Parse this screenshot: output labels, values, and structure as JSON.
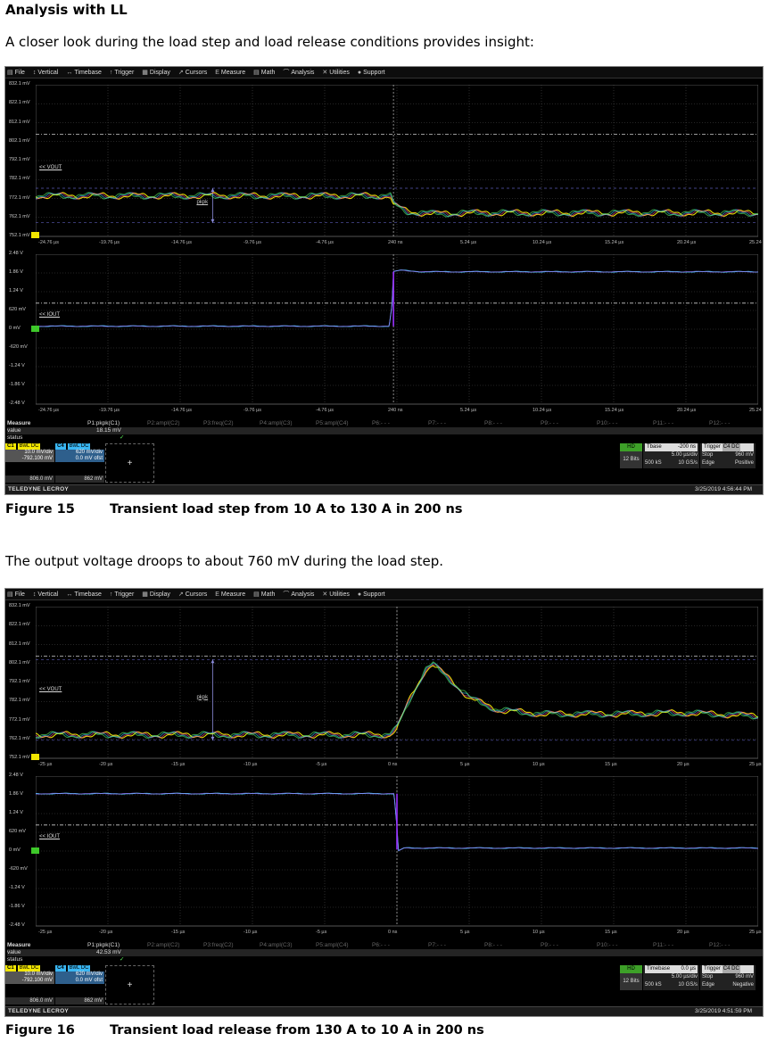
{
  "heading": "Analysis with LL",
  "intro": "A closer look during the load step and load release conditions provides insight:",
  "between_text": "The output voltage droops to about 760 mV during the load step.",
  "menu": [
    {
      "icon": "file-icon",
      "glyph": "▤",
      "label": "File"
    },
    {
      "icon": "vertical-icon",
      "glyph": "↕",
      "label": "Vertical"
    },
    {
      "icon": "timebase-icon",
      "glyph": "↔",
      "label": "Timebase"
    },
    {
      "icon": "trigger-icon",
      "glyph": "↑",
      "label": "Trigger"
    },
    {
      "icon": "display-icon",
      "glyph": "▦",
      "label": "Display"
    },
    {
      "icon": "cursors-icon",
      "glyph": "↗",
      "label": "Cursors"
    },
    {
      "icon": "measure-icon",
      "glyph": "Ε",
      "label": "Measure"
    },
    {
      "icon": "math-icon",
      "glyph": "▤",
      "label": "Math"
    },
    {
      "icon": "analysis-icon",
      "glyph": "⌒",
      "label": "Analysis"
    },
    {
      "icon": "utilities-icon",
      "glyph": "✕",
      "label": "Utilities"
    },
    {
      "icon": "support-icon",
      "glyph": "●",
      "label": "Support"
    }
  ],
  "colors": {
    "ch1": "#f2e600",
    "ch4": "#39b6f2",
    "marker_green": "#3ec82a",
    "grid": "#4a4a4a"
  },
  "common": {
    "vout_tag": "<< VOUT",
    "iout_tag": "<< IOUT",
    "cursor_label": "pkpk",
    "brand": "TELEDYNE LECROY",
    "measure_row_label": "Measure",
    "value_row_label": "value",
    "status_row_label": "status",
    "status_mark": "✓",
    "p1": "P1:pkpk(C1)",
    "others": [
      "P2:ampl(C2)",
      "P3:freq(C2)",
      "P4:ampl(C3)",
      "P5:ampl(C4)",
      "P6:- - -",
      "P7:- - -",
      "P8:- - -",
      "P9:- - -",
      "P10:- - -",
      "P11:- - -",
      "P12:- - -"
    ],
    "ch1": {
      "name": "C1",
      "flags": "BwL DC",
      "vdiv": "10.0 mV/div",
      "ofst": "-792.100 mV",
      "level": "806.0 mV"
    },
    "ch4": {
      "name": "C4",
      "flags": "BwL DC",
      "vdiv": "620 mV/div",
      "ofst": "0.0 mV ofst",
      "level": "862 mV"
    },
    "add": "+",
    "hd": "HD",
    "bits": "12 Bits",
    "samples": "500 kS",
    "rate": "10 GS/s",
    "tdiv": "5.00 µs/div",
    "trig_label": "Trigger",
    "trig_flags": "C4 DC",
    "trig_mode": "Stop",
    "trig_level": "960 mV",
    "trig_type": "Edge",
    "upper_ylabels": [
      "832.1 mV",
      "822.1 mV",
      "812.1 mV",
      "802.1 mV",
      "792.1 mV",
      "782.1 mV",
      "772.1 mV",
      "762.1 mV",
      "752.1 mV"
    ],
    "lower_ylabels": [
      "2.48 V",
      "1.86 V",
      "1.24 V",
      "620 mV",
      "0 mV",
      "-620 mV",
      "-1.24 V",
      "-1.86 V",
      "-2.48 V"
    ]
  },
  "figures": [
    {
      "caption_num": "Figure 15",
      "caption_text": "Transient load step from 10 A to 130 A in 200 ns",
      "xlabels": [
        "-24.76 µs",
        "-19.76 µs",
        "-14.76 µs",
        "-9.76 µs",
        "-4.76 µs",
        "240 ns",
        "5.24 µs",
        "10.24 µs",
        "15.24 µs",
        "20.24 µs",
        "25.24 µs"
      ],
      "pkpk_value": "18.15 mV",
      "tb_label": "Tbase",
      "tb_delay": "-200 ns",
      "trig_slope": "Positive",
      "timestamp": "3/25/2019 4:56:44 PM",
      "chart_data": {
        "type": "line",
        "x_unit": "µs",
        "xlim": [
          -24.76,
          25.24
        ],
        "series": [
          {
            "name": "VOUT",
            "channel": "C1",
            "y_unit": "mV",
            "ylim": [
              752.1,
              832.1
            ],
            "x": [
              -24.76,
              -0.2,
              0.0,
              1.0,
              3.0,
              5.0,
              10.0,
              15.0,
              20.0,
              25.24
            ],
            "y": [
              773.5,
              773.5,
              769.0,
              765.0,
              764.0,
              764.5,
              764.5,
              764.5,
              764.5,
              764.5
            ]
          },
          {
            "name": "IOUT",
            "channel": "C4",
            "y_unit": "V",
            "ylim": [
              -2.48,
              2.48
            ],
            "x": [
              -24.76,
              -0.3,
              -0.1,
              0.0,
              0.5,
              2.0,
              25.24
            ],
            "y": [
              0.1,
              0.1,
              0.8,
              1.9,
              1.95,
              1.9,
              1.9
            ]
          }
        ],
        "cursors_mV": [
          777.5,
          759.3
        ],
        "dashed_levels": {
          "upper_mV": 806.0,
          "lower_V": 0.862
        }
      }
    },
    {
      "caption_num": "Figure 16",
      "caption_text": "Transient load release from 130 A to 10 A in 200 ns",
      "xlabels": [
        "-25 µs",
        "-20 µs",
        "-15 µs",
        "-10 µs",
        "-5 µs",
        "0 ns",
        "5 µs",
        "10 µs",
        "15 µs",
        "20 µs",
        "25 µs"
      ],
      "pkpk_value": "42.53 mV",
      "tb_label": "Timebase",
      "tb_delay": "0.0 µs",
      "trig_slope": "Negative",
      "timestamp": "3/25/2019 4:51:59 PM",
      "chart_data": {
        "type": "line",
        "x_unit": "µs",
        "xlim": [
          -25,
          25
        ],
        "series": [
          {
            "name": "VOUT",
            "channel": "C1",
            "y_unit": "mV",
            "ylim": [
              752.1,
              832.1
            ],
            "x": [
              -25,
              -0.5,
              0.0,
              1.0,
              2.0,
              2.5,
              3.5,
              5.0,
              7.0,
              10.0,
              15.0,
              20.0,
              25.0
            ],
            "y": [
              764.5,
              764.5,
              768.0,
              785.0,
              799.0,
              801.5,
              795.0,
              784.0,
              777.5,
              775.5,
              775.5,
              776.0,
              774.5
            ]
          },
          {
            "name": "IOUT",
            "channel": "C4",
            "y_unit": "V",
            "ylim": [
              -2.48,
              2.48
            ],
            "x": [
              -25,
              -0.2,
              0.0,
              0.1,
              0.5,
              1.5,
              25
            ],
            "y": [
              1.9,
              1.9,
              0.8,
              0.0,
              0.1,
              0.1,
              0.1
            ]
          }
        ],
        "cursors_mV": [
          804.2,
          761.6
        ],
        "dashed_levels": {
          "upper_mV": 806.0,
          "lower_V": 0.862
        }
      }
    }
  ]
}
